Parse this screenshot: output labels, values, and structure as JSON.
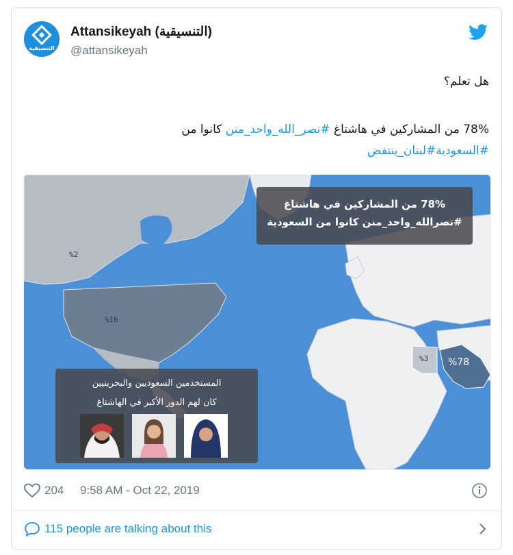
{
  "user": {
    "display_name": "Attansikeyah (التنسيقية)",
    "handle": "@attansikeyah",
    "avatar_text": "التنسيقية"
  },
  "tweet": {
    "line1": "هل تعلم؟",
    "line2_prefix": "78% من المشاركين في هاشتاغ ",
    "line2_link": "#نصر_الله_واحد_منن",
    "line2_suffix": " كانوا من",
    "line3_links": "#السعودية#لبنان_ينتفض"
  },
  "media": {
    "box1_line1": "78% من المشاركين في هاشتاغ",
    "box1_line2": "#نصرالله_واحد_منن كانوا من السعودية",
    "box2_line1": "المستخدمين السعوديين والبحرينيين",
    "box2_line2": "كان لهم الدور الأكبر في الهاشتاغ",
    "label_canada": "%2",
    "label_usa": "%16",
    "label_egypt": "%3",
    "label_saudi": "%78"
  },
  "footer": {
    "likes": "204",
    "timestamp": "9:58 AM - Oct 22, 2019",
    "talking": "115 people are talking about this"
  },
  "colors": {
    "accent": "#1b95e0",
    "ocean": "#4b8fd6",
    "land": "#eef0f2",
    "highlight": "#4f6f93"
  }
}
